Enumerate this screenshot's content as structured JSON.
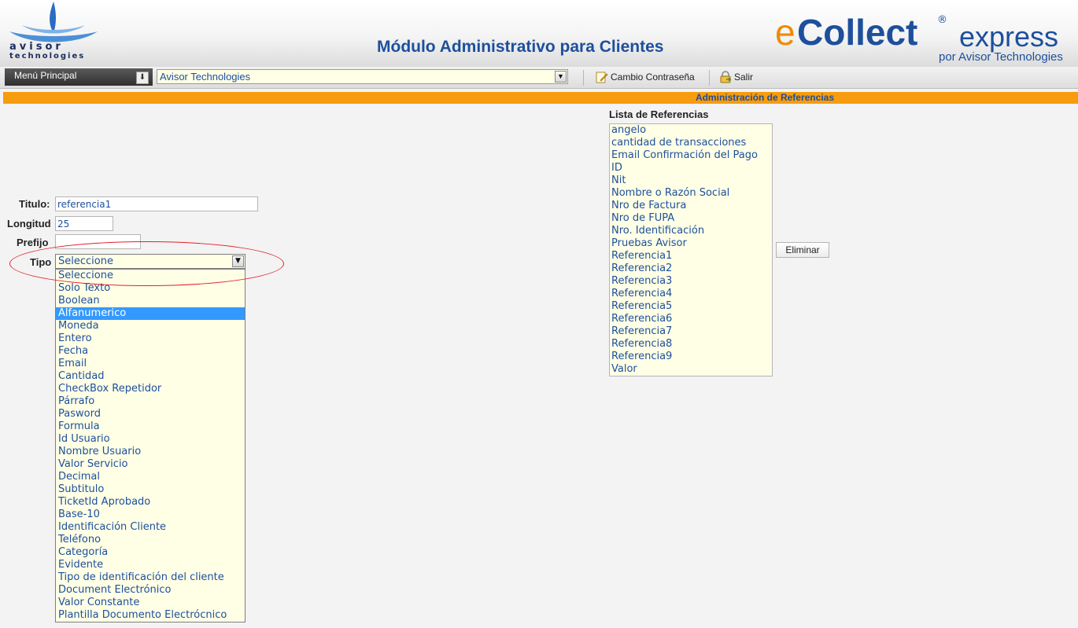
{
  "header": {
    "logo": {
      "line1": "avisor",
      "line2": "technologies"
    },
    "title": "Módulo Administrativo para Clientes",
    "brand": {
      "e": "e",
      "collect": "Collect",
      "reg": "®",
      "express": "express",
      "sub": "por Avisor Technologies"
    }
  },
  "toolbar": {
    "menu_label": "Menú Principal",
    "company": "Avisor Technologies",
    "change_password": "Cambio Contraseña",
    "logout": "Salir"
  },
  "section": {
    "title": "Administración de Referencias"
  },
  "form": {
    "titulo_label": "Titulo:",
    "titulo_value": "referencia1",
    "longitud_label": "Longitud",
    "longitud_value": "25",
    "prefijo_label": "Prefijo",
    "prefijo_value": "",
    "tipo_label": "Tipo",
    "tipo_value": "Seleccione",
    "tipo_options": [
      "Seleccione",
      "Solo Texto",
      "Boolean",
      "Alfanumerico",
      "Moneda",
      "Entero",
      "Fecha",
      "Email",
      "Cantidad",
      "CheckBox Repetidor",
      "Párrafo",
      "Pasword",
      "Formula",
      "Id Usuario",
      "Nombre Usuario",
      "Valor Servicio",
      "Decimal",
      "Subtitulo",
      "TicketId Aprobado",
      "Base-10",
      "Identificación Cliente",
      "Teléfono",
      "Categoría",
      "Evidente",
      "Tipo de identificación del cliente",
      "Document Electrónico",
      "Valor Constante",
      "Plantilla Documento Electrócnico"
    ],
    "tipo_highlighted": "Alfanumerico"
  },
  "references": {
    "title": "Lista de Referencias",
    "items": [
      "angelo",
      "cantidad de transacciones",
      "Email Confirmación del Pago",
      "ID",
      "Nit",
      "Nombre o Razón Social",
      "Nro de Factura",
      "Nro de FUPA",
      "Nro. Identificación",
      "Pruebas Avisor",
      "Referencia1",
      "Referencia2",
      "Referencia3",
      "Referencia4",
      "Referencia5",
      "Referencia6",
      "Referencia7",
      "Referencia8",
      "Referencia9",
      "Valor"
    ],
    "delete_label": "Eliminar"
  },
  "colors": {
    "accent_orange": "#f79c0e",
    "brand_blue": "#1d4f9c",
    "field_bg": "#ffffe6",
    "selection": "#3399ff",
    "annotation_red": "#e0202a"
  }
}
